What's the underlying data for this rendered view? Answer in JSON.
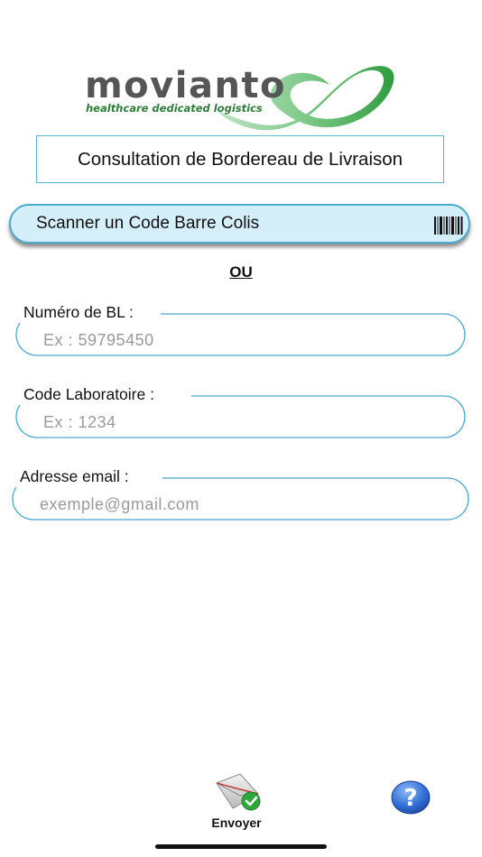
{
  "logo": {
    "wordmark": "movianto",
    "tagline": "healthcare dedicated logistics",
    "color_text": "#555555",
    "color_swoosh": "#3aa845"
  },
  "header": {
    "title": "Consultation de Bordereau de Livraison"
  },
  "scan_button": {
    "label": "Scanner un Code Barre Colis",
    "icon": "barcode-icon"
  },
  "separator": "OU",
  "form": {
    "bl_number": {
      "label": "Numéro de BL :",
      "placeholder": "Ex : 59795450",
      "value": ""
    },
    "lab_code": {
      "label": "Code Laboratoire :",
      "placeholder": "Ex : 1234",
      "value": ""
    },
    "email": {
      "label": "Adresse email :",
      "placeholder": "exemple@gmail.com",
      "value": ""
    }
  },
  "tabbar": {
    "send": {
      "label": "Envoyer",
      "icon": "envelope-check-icon"
    },
    "help": {
      "icon": "help-icon"
    }
  },
  "colors": {
    "accent": "#4aa9cc",
    "scan_bg": "#d5effa",
    "help_blue": "#2f6fd6",
    "check_green": "#2fa83a"
  }
}
